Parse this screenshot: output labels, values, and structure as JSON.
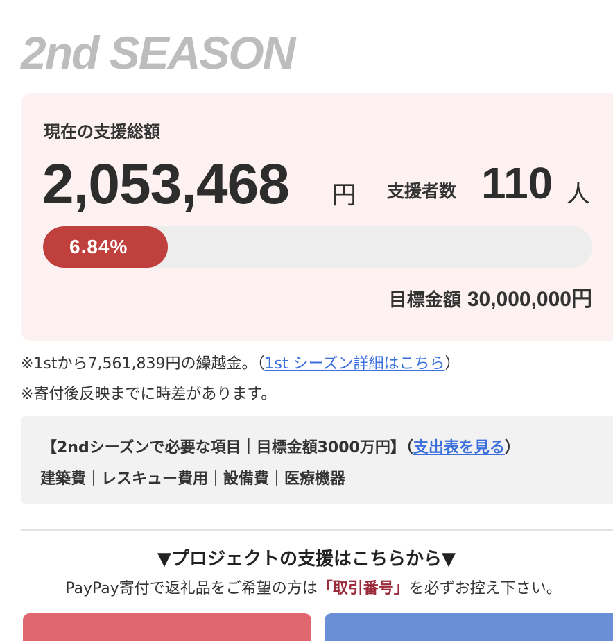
{
  "header": {
    "season_title": "2nd SEASON"
  },
  "summary": {
    "total_label": "現在の支援総額",
    "total_amount": "2,053,468",
    "yen_unit": "円",
    "supporters_label": "支援者数",
    "supporters_count": "110",
    "person_unit": "人",
    "progress_percent_text": "6.84%",
    "progress_fraction": 0.0684,
    "goal_label": "目標金額",
    "goal_value": "30,000,000円"
  },
  "notes": {
    "carryover_prefix": "※1stから7,561,839円の繰越金。（",
    "carryover_link": "1st シーズン詳細はこちら",
    "carryover_suffix": "）",
    "delay_note": "※寄付後反映までに時差があります。"
  },
  "items_box": {
    "title_prefix": "【2ndシーズンで必要な項目｜目標金額3000万円】（",
    "title_link": "支出表を見る",
    "title_suffix": "）",
    "items_list": "建築費｜レスキュー費用｜設備費｜医療機器"
  },
  "cta": {
    "heading": "▼プロジェクトの支援はこちらから▼",
    "note_prefix": "PayPay寄付で返礼品をご希望の方は",
    "note_emphasis": "「取引番号」",
    "note_suffix": "を必ずお控え下さい。"
  },
  "colors": {
    "accent_red": "#c0403e",
    "card_background": "#fdf1f1",
    "link_blue": "#3a6fdc",
    "button_left": "#e0666f",
    "button_right": "#6b8fd6"
  }
}
